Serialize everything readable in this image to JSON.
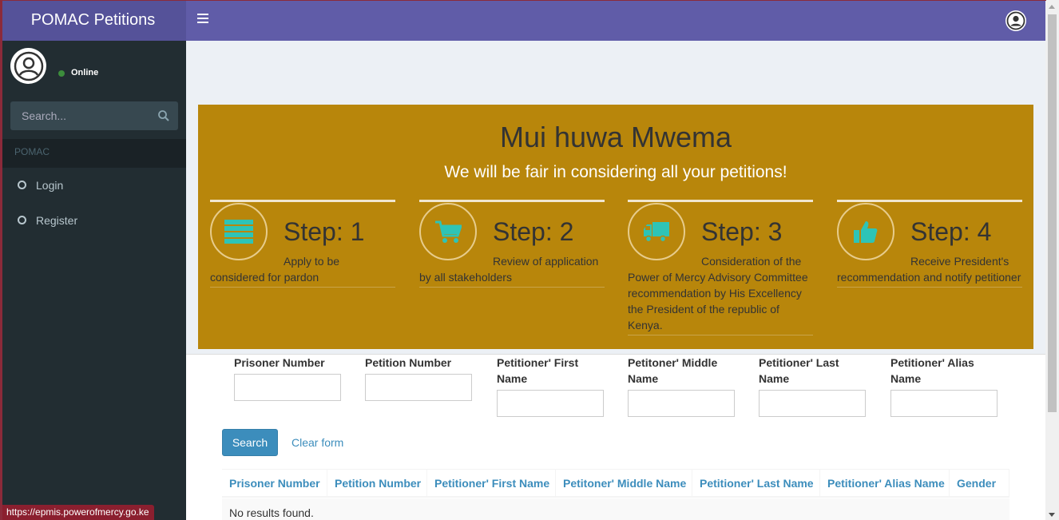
{
  "header": {
    "app_title": "POMAC Petitions"
  },
  "sidebar": {
    "status": "Online",
    "search_placeholder": "Search...",
    "section_header": "POMAC",
    "items": [
      {
        "label": "Login"
      },
      {
        "label": "Register"
      }
    ]
  },
  "hero": {
    "title": "Mui huwa Mwema",
    "subtitle": "We will be fair in considering all your petitions!",
    "steps": [
      {
        "title": "Step: 1",
        "description": "Apply to be considered for pardon",
        "icon": "list-icon"
      },
      {
        "title": "Step: 2",
        "description": "Review of application by all stakeholders",
        "icon": "cart-icon"
      },
      {
        "title": "Step: 3",
        "description": "Consideration of the Power of Mercy Advisory Committee recommendation by His Excellency the President of the republic of Kenya.",
        "icon": "truck-icon"
      },
      {
        "title": "Step: 4",
        "description": "Receive President's recommendation and notify petitioner",
        "icon": "thumbs-up-icon"
      }
    ]
  },
  "form": {
    "fields": [
      {
        "label": "Prisoner Number",
        "value": ""
      },
      {
        "label": "Petition Number",
        "value": ""
      },
      {
        "label": "Petitioner' First Name",
        "value": ""
      },
      {
        "label": "Petitoner' Middle Name",
        "value": ""
      },
      {
        "label": "Petitioner' Last Name",
        "value": ""
      },
      {
        "label": "Petitioner' Alias Name",
        "value": ""
      }
    ],
    "search_label": "Search",
    "clear_label": "Clear form"
  },
  "table": {
    "columns": [
      "Prisoner Number",
      "Petition Number",
      "Petitioner' First Name",
      "Petitoner' Middle Name",
      "Petitioner' Last Name",
      "Petitioner' Alias Name",
      "Gender"
    ],
    "empty_text": "No results found."
  },
  "statusbar": {
    "url": "https://epmis.powerofmercy.go.ke"
  },
  "colors": {
    "navbar": "#605ca8",
    "sidebar": "#222d32",
    "hero": "#b8860b",
    "step_icon": "#2ec4b6",
    "link": "#3c8dbc"
  }
}
